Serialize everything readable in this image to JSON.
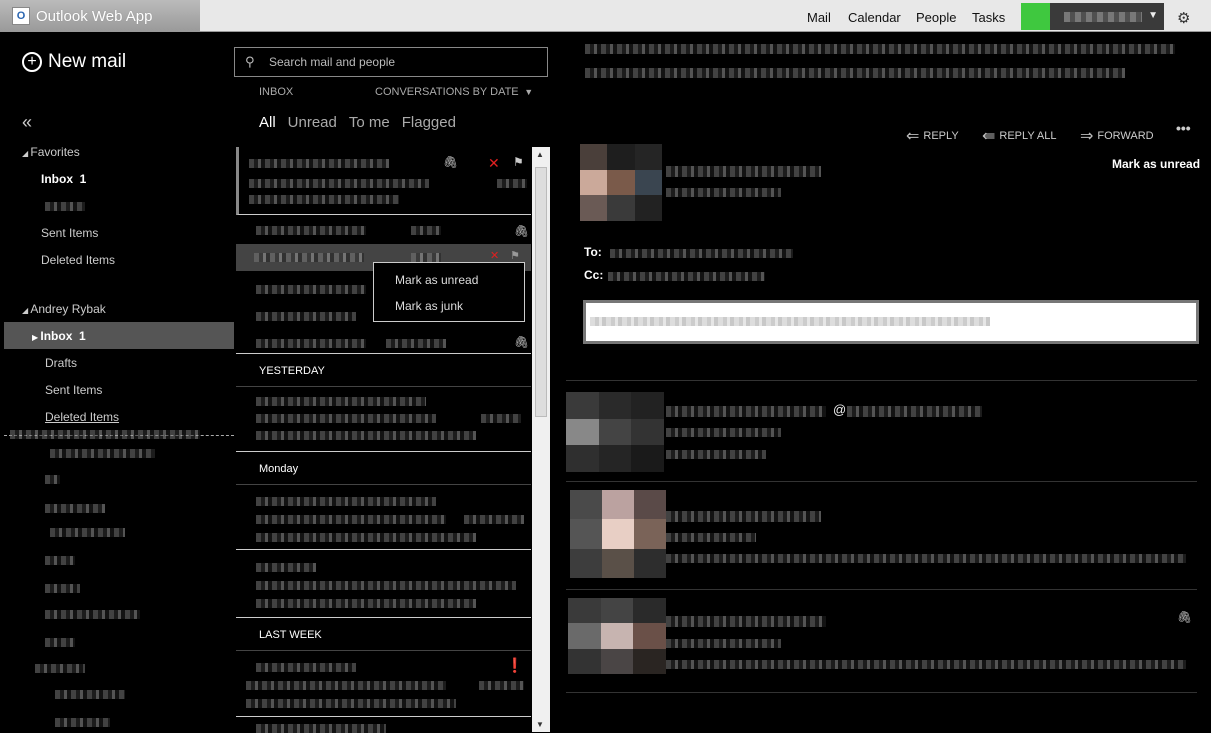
{
  "app": {
    "title": "Outlook Web App"
  },
  "topnav": {
    "mail": "Mail",
    "calendar": "Calendar",
    "people": "People",
    "tasks": "Tasks"
  },
  "leftnav": {
    "new_mail": "New mail",
    "favorites_header": "Favorites",
    "favorites": {
      "inbox": "Inbox",
      "inbox_count": "1",
      "sent": "Sent Items",
      "deleted": "Deleted Items"
    },
    "account_header": "Andrey Rybak",
    "account": {
      "inbox": "Inbox",
      "inbox_count": "1",
      "drafts": "Drafts",
      "sent": "Sent Items",
      "deleted": "Deleted Items"
    }
  },
  "list": {
    "search_placeholder": "Search mail and people",
    "folder": "INBOX",
    "sort": "CONVERSATIONS BY DATE",
    "filters": {
      "all": "All",
      "unread": "Unread",
      "to_me": "To me",
      "flagged": "Flagged"
    },
    "groups": {
      "yesterday": "YESTERDAY",
      "monday": "Monday",
      "last_week": "LAST WEEK"
    }
  },
  "context_menu": {
    "mark_unread": "Mark as unread",
    "mark_junk": "Mark as junk"
  },
  "reading": {
    "reply": "REPLY",
    "reply_all": "REPLY ALL",
    "forward": "FORWARD",
    "mark_unread": "Mark as unread",
    "to_label": "To:",
    "cc_label": "Cc:",
    "at_sign": "@"
  },
  "colors": {
    "presence": "#3fc83f",
    "flag_red": "#e02020"
  }
}
